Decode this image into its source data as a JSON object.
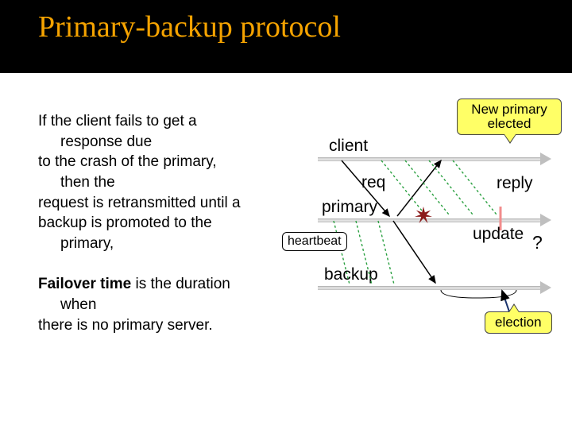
{
  "title": "Primary-backup protocol",
  "para1": {
    "l1": "If the client fails to get a",
    "l2": "response due",
    "l3": "to the crash of the primary,",
    "l4": "then the",
    "l5": "request is retransmitted until a",
    "l6": "backup is promoted to the",
    "l7": "primary,"
  },
  "para2": {
    "l1": "Failover time",
    "l1b": " is the duration",
    "l2": "when",
    "l3": "there is no primary server."
  },
  "diagram": {
    "client": "client",
    "primary": "primary",
    "backup": "backup",
    "req": "req",
    "reply": "reply",
    "update": "update",
    "heartbeat": "heartbeat",
    "new_primary": "New primary\nelected",
    "election": "election",
    "qmark": "?"
  }
}
